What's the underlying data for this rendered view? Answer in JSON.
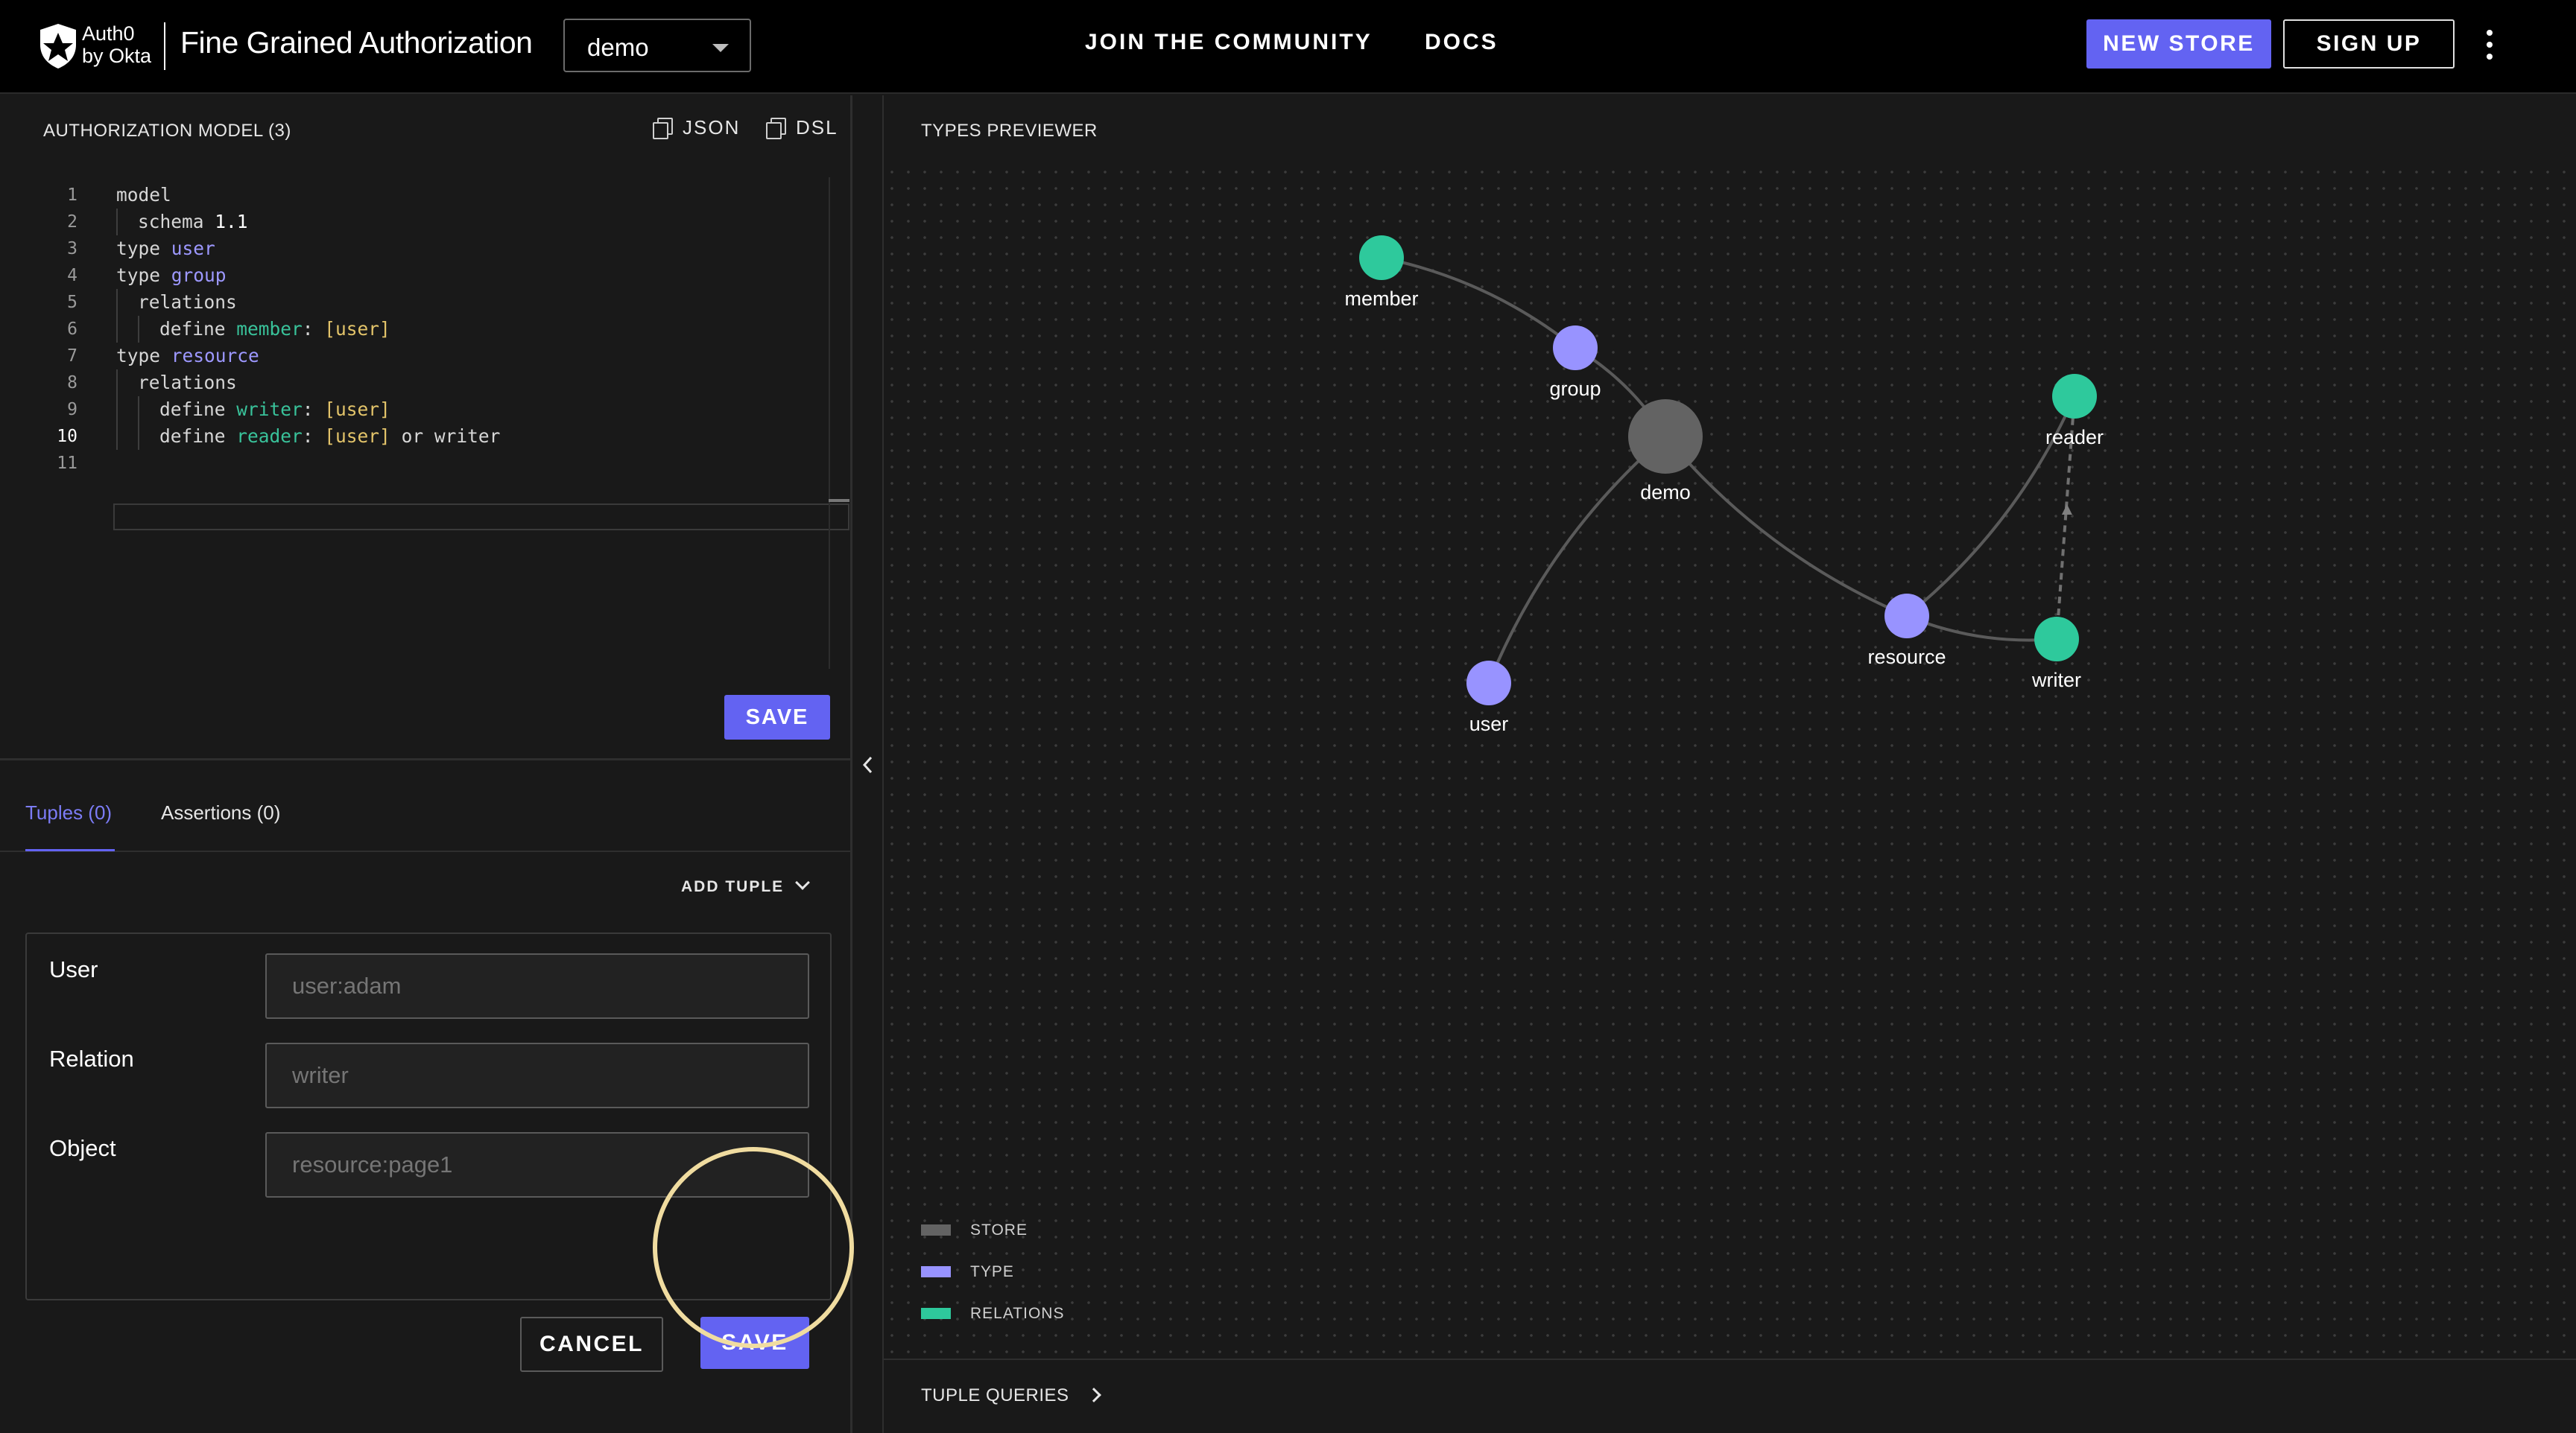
{
  "header": {
    "brand_line1": "Auth0",
    "brand_line2": "by Okta",
    "app_title": "Fine Grained Authorization",
    "store_select_value": "demo",
    "nav": {
      "community": "JOIN  THE COMMUNITY",
      "docs": "DOCS"
    },
    "new_store_label": "NEW STORE",
    "sign_up_label": "SIGN UP"
  },
  "model_panel": {
    "title": "AUTHORIZATION MODEL (3)",
    "json_label": "JSON",
    "dsl_label": "DSL",
    "save_label": "SAVE",
    "active_line": 10,
    "code": [
      {
        "n": "1",
        "indent": 0,
        "tokens": [
          {
            "t": "model",
            "c": ""
          }
        ]
      },
      {
        "n": "2",
        "indent": 1,
        "tokens": [
          {
            "t": "schema ",
            "c": ""
          },
          {
            "t": "1.1",
            "c": "num"
          }
        ]
      },
      {
        "n": "3",
        "indent": 0,
        "tokens": [
          {
            "t": "type ",
            "c": ""
          },
          {
            "t": "user",
            "c": "type"
          }
        ]
      },
      {
        "n": "4",
        "indent": 0,
        "tokens": [
          {
            "t": "type ",
            "c": ""
          },
          {
            "t": "group",
            "c": "type"
          }
        ]
      },
      {
        "n": "5",
        "indent": 1,
        "tokens": [
          {
            "t": "relations",
            "c": ""
          }
        ]
      },
      {
        "n": "6",
        "indent": 2,
        "tokens": [
          {
            "t": "define ",
            "c": ""
          },
          {
            "t": "member",
            "c": "rel"
          },
          {
            "t": ": ",
            "c": ""
          },
          {
            "t": "[user]",
            "c": "br"
          }
        ]
      },
      {
        "n": "7",
        "indent": 0,
        "tokens": [
          {
            "t": "type ",
            "c": ""
          },
          {
            "t": "resource",
            "c": "type"
          }
        ]
      },
      {
        "n": "8",
        "indent": 1,
        "tokens": [
          {
            "t": "relations",
            "c": ""
          }
        ]
      },
      {
        "n": "9",
        "indent": 2,
        "tokens": [
          {
            "t": "define ",
            "c": ""
          },
          {
            "t": "writer",
            "c": "rel"
          },
          {
            "t": ": ",
            "c": ""
          },
          {
            "t": "[user]",
            "c": "br"
          }
        ]
      },
      {
        "n": "10",
        "indent": 2,
        "tokens": [
          {
            "t": "define ",
            "c": ""
          },
          {
            "t": "reader",
            "c": "rel"
          },
          {
            "t": ": ",
            "c": ""
          },
          {
            "t": "[user]",
            "c": "br"
          },
          {
            "t": " or writer",
            "c": ""
          }
        ]
      },
      {
        "n": "11",
        "indent": 0,
        "tokens": []
      }
    ]
  },
  "tuples_panel": {
    "tabs": {
      "tuples": "Tuples (0)",
      "assertions": "Assertions (0)"
    },
    "add_tuple_label": "ADD TUPLE",
    "form": {
      "user_label": "User",
      "user_placeholder": "user:adam",
      "relation_label": "Relation",
      "relation_placeholder": "writer",
      "object_label": "Object",
      "object_placeholder": "resource:page1"
    },
    "cancel_label": "CANCEL",
    "save_label": "SAVE"
  },
  "types_previewer": {
    "title": "TYPES PREVIEWER",
    "colors": {
      "store": "#636363",
      "type": "#9893ff",
      "relation": "#2ec99c",
      "edge": "#5a5a5a"
    },
    "nodes": [
      {
        "id": "demo",
        "label": "demo",
        "kind": "store"
      },
      {
        "id": "group",
        "label": "group",
        "kind": "type"
      },
      {
        "id": "member",
        "label": "member",
        "kind": "relation"
      },
      {
        "id": "user",
        "label": "user",
        "kind": "type"
      },
      {
        "id": "resource",
        "label": "resource",
        "kind": "type"
      },
      {
        "id": "reader",
        "label": "reader",
        "kind": "relation"
      },
      {
        "id": "writer",
        "label": "writer",
        "kind": "relation"
      }
    ],
    "edges": [
      {
        "from": "demo",
        "to": "group",
        "style": "solid"
      },
      {
        "from": "group",
        "to": "member",
        "style": "solid"
      },
      {
        "from": "demo",
        "to": "user",
        "style": "solid"
      },
      {
        "from": "demo",
        "to": "resource",
        "style": "solid"
      },
      {
        "from": "resource",
        "to": "reader",
        "style": "solid"
      },
      {
        "from": "resource",
        "to": "writer",
        "style": "solid"
      },
      {
        "from": "writer",
        "to": "reader",
        "style": "dashed"
      }
    ],
    "legend": {
      "store": "STORE",
      "type": "TYPE",
      "relations": "RELATIONS"
    },
    "tuple_queries_label": "TUPLE QUERIES"
  }
}
